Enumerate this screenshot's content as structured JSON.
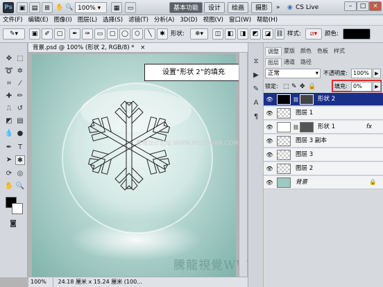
{
  "titlebar": {
    "app_logo": "Ps",
    "zoom": "100%",
    "workspace_tabs": [
      "基本功能",
      "设计",
      "绘画",
      "摄影"
    ],
    "more": "»",
    "cslive": "CS Live"
  },
  "menu": [
    "文件(F)",
    "编辑(E)",
    "图像(I)",
    "图层(L)",
    "选择(S)",
    "滤镜(T)",
    "分析(A)",
    "3D(D)",
    "视图(V)",
    "窗口(W)",
    "帮助(H)"
  ],
  "options": {
    "shape_label": "形状:",
    "style_label": "样式:",
    "color_label": "颜色:",
    "color_value": "#000000"
  },
  "document": {
    "tab_title": "背景.psd @ 100% (形状 2, RGB/8) *",
    "close": "×",
    "zoom": "100%",
    "doc_size": "24.18 厘米 x 15.24 厘米 (100..."
  },
  "callout": "设置“形状 2”的填充",
  "watermark": "騰龍視覺WWW.TLVI.NET",
  "site_watermark": "思缘设计论坛 WWW.MISSYUAN.COM",
  "panel": {
    "tabs_top": [
      "调整",
      "蒙版",
      "颜色",
      "色板",
      "样式"
    ],
    "tabs_layers": [
      "图层",
      "通道",
      "路径"
    ],
    "blend_mode": "正常",
    "opacity_label": "不透明度:",
    "opacity_value": "100%",
    "lock_label": "锁定:",
    "fill_label": "填充:",
    "fill_value": "0%",
    "layers": [
      {
        "name": "形状 2",
        "selected": true,
        "fx": ""
      },
      {
        "name": "图层 1",
        "selected": false,
        "fx": ""
      },
      {
        "name": "形状 1",
        "selected": false,
        "fx": "fx"
      },
      {
        "name": "图层 3 副本",
        "selected": false,
        "fx": ""
      },
      {
        "name": "图层 3",
        "selected": false,
        "fx": ""
      },
      {
        "name": "图层 2",
        "selected": false,
        "fx": ""
      },
      {
        "name": "背景",
        "selected": false,
        "fx": "lock"
      }
    ]
  }
}
